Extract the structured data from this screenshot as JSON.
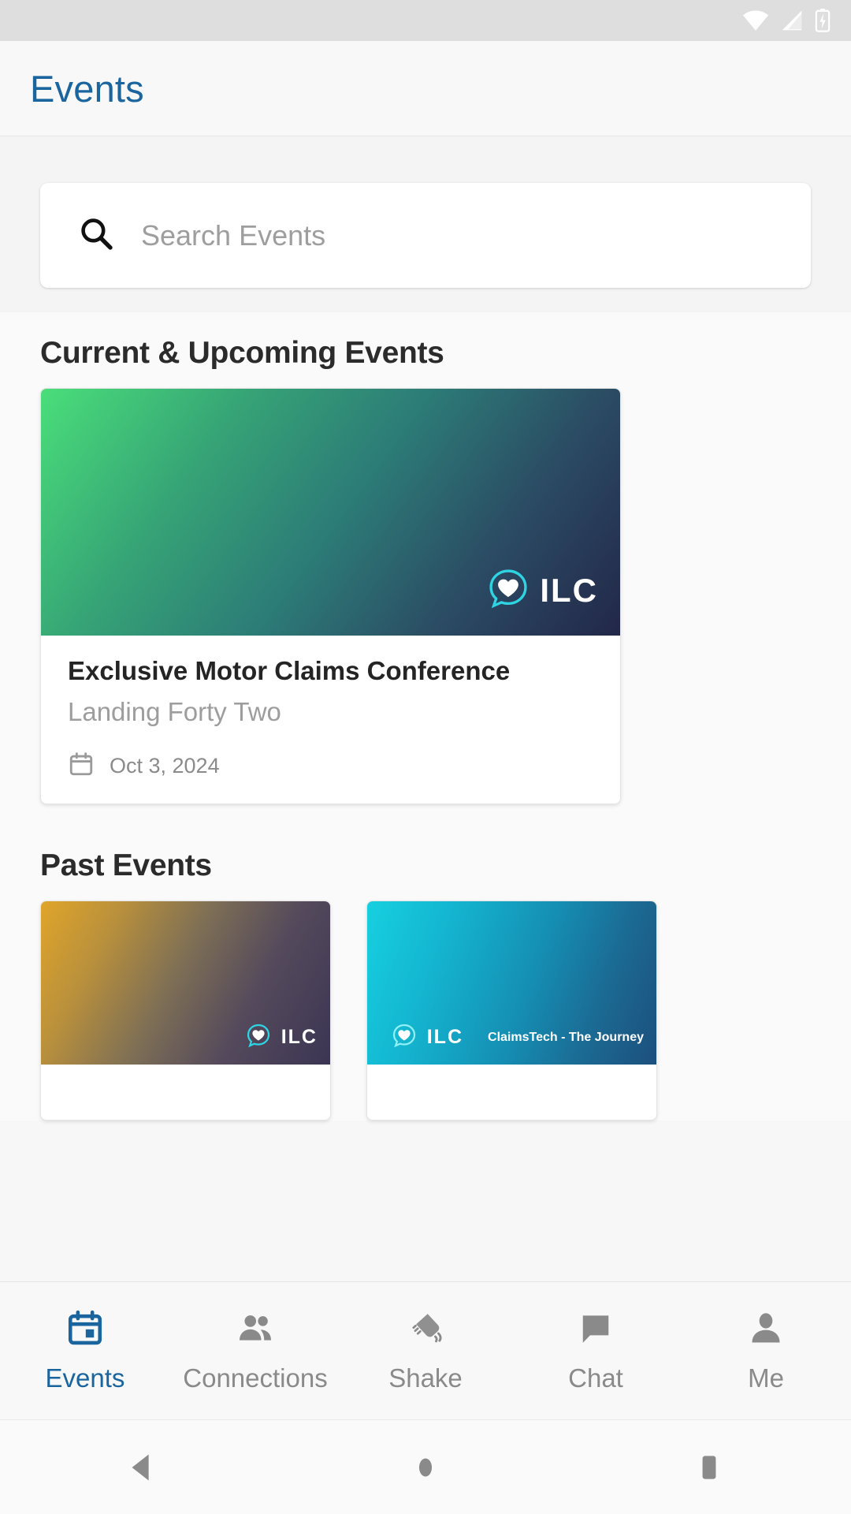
{
  "status_bar": {
    "wifi_icon": "wifi-icon",
    "cellular_icon": "cellular-signal-icon",
    "battery_icon": "battery-charging-icon"
  },
  "app_bar": {
    "title": "Events",
    "title_color": "#1a659e"
  },
  "search": {
    "icon": "search-icon",
    "placeholder": "Search Events",
    "value": ""
  },
  "sections": {
    "upcoming_title": "Current & Upcoming Events",
    "past_title": "Past Events"
  },
  "upcoming_events": [
    {
      "title": "Exclusive Motor Claims Conference",
      "venue": "Landing Forty Two",
      "date": "Oct 3, 2024",
      "date_icon": "calendar-icon",
      "brand": "ILC",
      "brand_icon": "heart-chat-bubble-icon"
    }
  ],
  "past_events": [
    {
      "brand": "ILC",
      "brand_icon": "heart-chat-bubble-icon",
      "tagline": ""
    },
    {
      "brand": "ILC",
      "brand_icon": "heart-chat-bubble-icon",
      "tagline": "ClaimsTech - The Journey"
    }
  ],
  "bottom_nav": {
    "active_color": "#1a659e",
    "inactive_color": "#8a8a8a",
    "items": [
      {
        "label": "Events",
        "icon": "calendar-icon",
        "active": true
      },
      {
        "label": "Connections",
        "icon": "people-icon",
        "active": false
      },
      {
        "label": "Shake",
        "icon": "shake-phone-icon",
        "active": false
      },
      {
        "label": "Chat",
        "icon": "chat-bubble-icon",
        "active": false
      },
      {
        "label": "Me",
        "icon": "person-icon",
        "active": false
      }
    ]
  },
  "system_nav": {
    "back": "back-triangle-icon",
    "home": "home-circle-icon",
    "recents": "recents-square-icon"
  }
}
